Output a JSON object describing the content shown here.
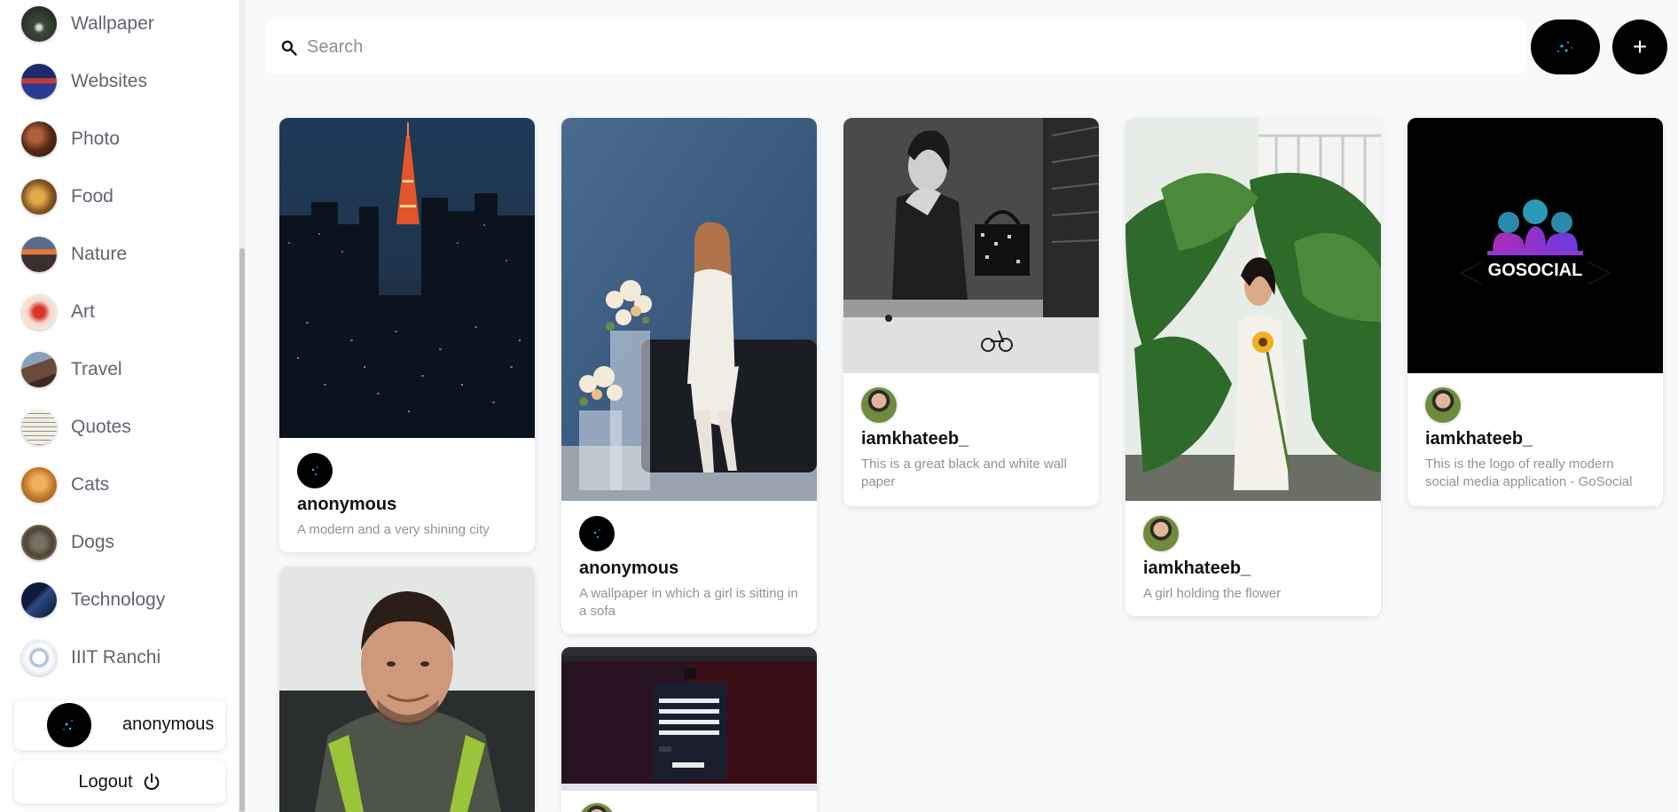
{
  "sidebar": {
    "categories": [
      {
        "label": "Wallpaper",
        "icon": "wallpaper-thumb"
      },
      {
        "label": "Websites",
        "icon": "websites-thumb"
      },
      {
        "label": "Photo",
        "icon": "photo-thumb"
      },
      {
        "label": "Food",
        "icon": "food-thumb"
      },
      {
        "label": "Nature",
        "icon": "nature-thumb"
      },
      {
        "label": "Art",
        "icon": "art-thumb"
      },
      {
        "label": "Travel",
        "icon": "travel-thumb"
      },
      {
        "label": "Quotes",
        "icon": "quotes-thumb"
      },
      {
        "label": "Cats",
        "icon": "cats-thumb"
      },
      {
        "label": "Dogs",
        "icon": "dogs-thumb"
      },
      {
        "label": "Technology",
        "icon": "technology-thumb"
      },
      {
        "label": "IIIT Ranchi",
        "icon": "iiit-ranchi-thumb"
      }
    ],
    "user": {
      "name": "anonymous"
    },
    "logout_label": "Logout"
  },
  "header": {
    "search_placeholder": "Search",
    "add_label": "+"
  },
  "pins": [
    {
      "author": "anonymous",
      "description": "A modern and a very shining city",
      "image": "tokyo-city-night"
    },
    {
      "author": "",
      "description": "",
      "image": "man-portrait-green-backpack"
    },
    {
      "author": "anonymous",
      "description": "A wallpaper in which a girl is sitting in a sofa",
      "image": "girl-sitting-sofa"
    },
    {
      "author": "",
      "description": "",
      "image": "signup-form-screenshot"
    },
    {
      "author": "iamkhateeb_",
      "description": "This is a great black and white wall paper",
      "image": "black-white-wall-poster"
    },
    {
      "author": "iamkhateeb_",
      "description": "A girl holding the flower",
      "image": "girl-holding-sunflower"
    },
    {
      "author": "iamkhateeb_",
      "description": "This is the logo of really modern social media application - GoSocial",
      "image": "gosocial-logo",
      "image_text": "GOSOCIAL"
    }
  ],
  "colors": {
    "accent": "#000000",
    "background": "#f8f9fb",
    "muted_text": "#8e939c"
  }
}
